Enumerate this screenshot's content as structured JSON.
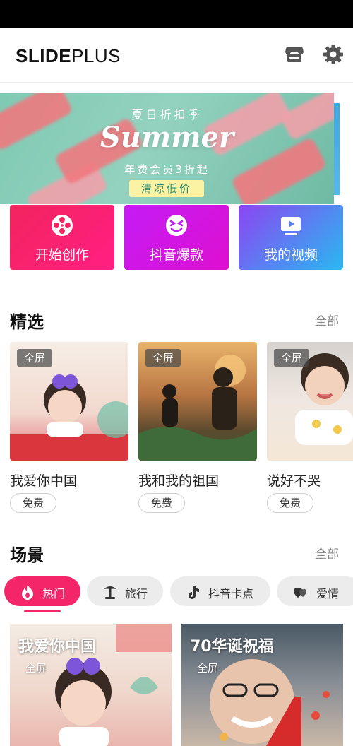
{
  "app": {
    "logo_bold": "SLIDE",
    "logo_light": "PLUS"
  },
  "header": {
    "store_icon": "store-icon",
    "settings_icon": "gear-icon"
  },
  "banner": {
    "top_text": "夏日折扣季",
    "title": "Summer",
    "subtitle": "年费会员3折起",
    "tag": "清凉低价"
  },
  "actions": [
    {
      "label": "开始创作",
      "icon": "film-reel-icon"
    },
    {
      "label": "抖音爆款",
      "icon": "funny-face-icon"
    },
    {
      "label": "我的视频",
      "icon": "play-video-icon"
    }
  ],
  "featured": {
    "title": "精选",
    "more": "全部",
    "items": [
      {
        "name": "我爱你中国",
        "badge": "全屏",
        "price": "免费"
      },
      {
        "name": "我和我的祖国",
        "badge": "全屏",
        "price": "免费"
      },
      {
        "name": "说好不哭",
        "badge": "全屏",
        "price": "免费"
      }
    ]
  },
  "scenes": {
    "title": "场景",
    "more": "全部",
    "tabs": [
      {
        "label": "热门",
        "icon": "flame-icon",
        "active": true
      },
      {
        "label": "旅行",
        "icon": "palm-tree-icon"
      },
      {
        "label": "抖音卡点",
        "icon": "tiktok-note-icon"
      },
      {
        "label": "爱情",
        "icon": "hearts-icon"
      }
    ],
    "cards": [
      {
        "title": "我爱你中国",
        "badge": "全屏"
      },
      {
        "title": "70华诞祝福",
        "badge": "全屏"
      }
    ]
  },
  "colors": {
    "accent": "#f5256a",
    "card_create": "#f3245e",
    "card_douyin": "#c41cf6",
    "card_video": "#2ab8f0"
  }
}
